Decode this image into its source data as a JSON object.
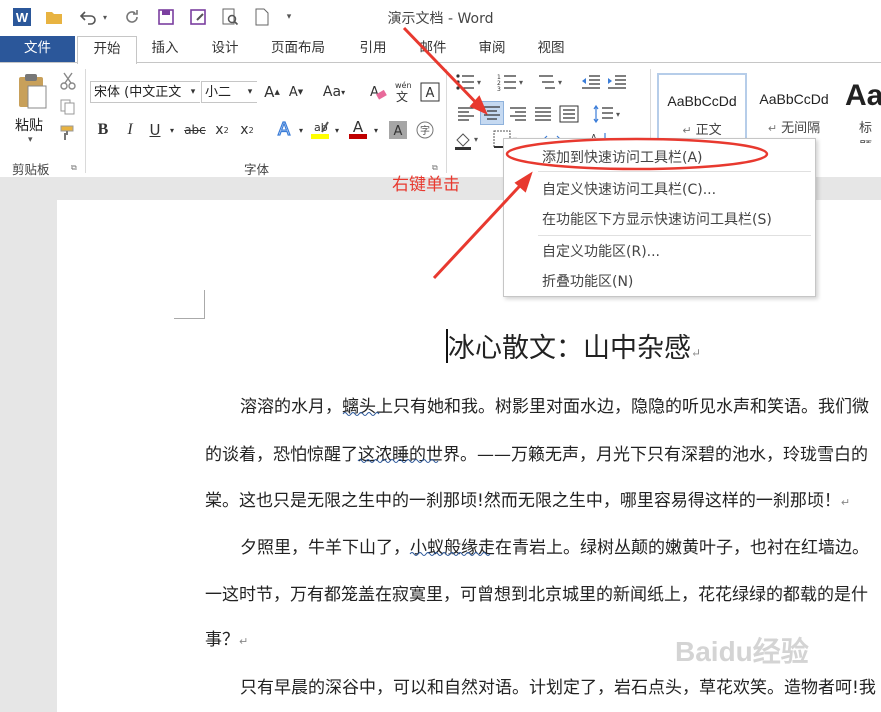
{
  "titlebar": {
    "title": "演示文档 - Word"
  },
  "tabs": [
    "文件",
    "开始",
    "插入",
    "设计",
    "页面布局",
    "引用",
    "邮件",
    "审阅",
    "视图"
  ],
  "ribbon": {
    "paste_label": "剪贴板",
    "paste_button": "粘贴",
    "font_name": "宋体 (中文正文",
    "font_size": "小二",
    "font_group_label": "字体",
    "styles": [
      {
        "sample": "AaBbCcDd",
        "name": "正文"
      },
      {
        "sample": "AaBbCcDd",
        "name": "无间隔"
      },
      {
        "sample": "Aa",
        "name": "标题"
      }
    ]
  },
  "context_menu": {
    "items": [
      "添加到快速访问工具栏(A)",
      "自定义快速访问工具栏(C)...",
      "在功能区下方显示快速访问工具栏(S)",
      "自定义功能区(R)...",
      "折叠功能区(N)"
    ]
  },
  "annotation": "右键单击",
  "document": {
    "title": "冰心散文：山中杂感",
    "lines": [
      "溶溶的水月，螭头上只有她和我。树影里对面水边，隐隐的听见水声和笑语。我们微",
      "的谈着，恐怕惊醒了这浓睡的世界。——万籁无声，月光下只有深碧的池水，玲珑雪白的",
      "棠。这也只是无限之生中的一刹那顷!然而无限之生中，哪里容易得这样的一刹那顷！",
      "夕照里，牛羊下山了，小蚁般缘走在青岩上。绿树丛颠的嫩黄叶子，也衬在红墙边。",
      "一这时节，万有都笼盖在寂寞里，可曾想到北京城里的新闻纸上，花花绿绿的都载的是什",
      "事？",
      "只有早晨的深谷中，可以和自然对语。计划定了，岩石点头，草花欢笑。造物者呵!我"
    ]
  },
  "watermark": "Baidu经验",
  "colors": {
    "accent": "#2b579a",
    "annotation": "#e8392f",
    "font_color_bar": "#c00000",
    "highlight_bar": "#ffff00"
  }
}
